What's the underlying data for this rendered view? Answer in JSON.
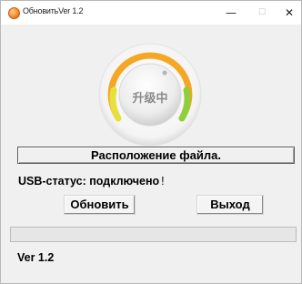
{
  "window": {
    "title": "ОбновитьVer 1.2",
    "controls": {
      "minimize": "—",
      "maximize": "☐",
      "close": "✕"
    }
  },
  "dial": {
    "label": "升级中"
  },
  "file_location": {
    "label": "Расположение файла."
  },
  "usb": {
    "status_text": "USB-статус: подключено",
    "mark": "!"
  },
  "buttons": {
    "update": "Обновить",
    "exit": "Выход"
  },
  "progress": {
    "value": 0
  },
  "footer": {
    "version": "Ver 1.2"
  },
  "colors": {
    "arc_orange": "#f5a623",
    "arc_yellow": "#e6e03a",
    "arc_green": "#8fcf3a",
    "progress_green": "#06b025",
    "window_bg": "#f0f0f0"
  }
}
